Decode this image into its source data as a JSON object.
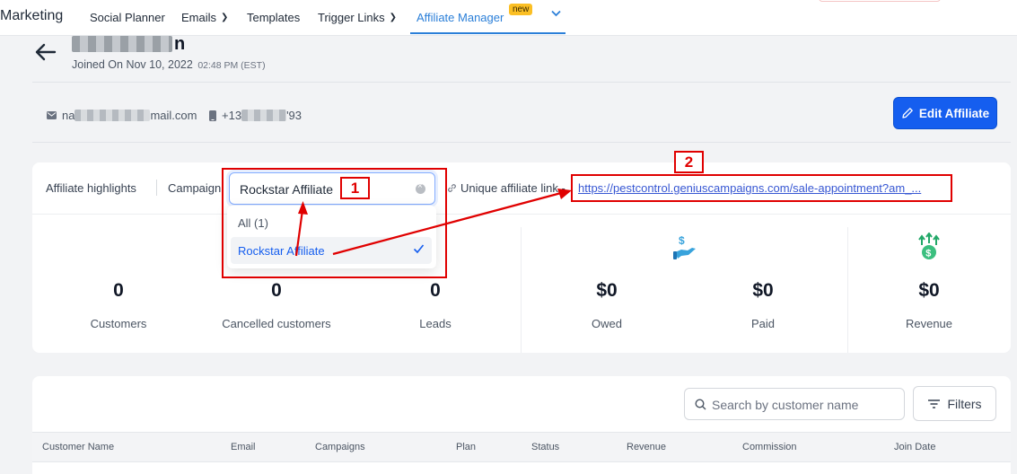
{
  "nav": {
    "brand": "Marketing",
    "items": [
      {
        "label": "Social Planner",
        "has_chevron": false
      },
      {
        "label": "Emails",
        "has_chevron": true
      },
      {
        "label": "Templates",
        "has_chevron": false
      },
      {
        "label": "Trigger Links",
        "has_chevron": true
      },
      {
        "label": "Affiliate Manager",
        "active": true,
        "badge": "new"
      }
    ],
    "active_color": "#2b7fd8"
  },
  "profile": {
    "name_visible_tail": "n",
    "joined_label": "Joined On Nov 10, 2022",
    "joined_time": "02:48 PM (EST)",
    "email_prefix": "na",
    "email_suffix": "mail.com",
    "phone_prefix": "+13",
    "phone_suffix": "'93",
    "edit_button": "Edit Affiliate",
    "accent": "#155eef"
  },
  "highlights": {
    "label": "Affiliate highlights",
    "campaign_label": "Campaign",
    "selected_campaign": "Rockstar Affiliate",
    "dropdown": {
      "all_option": "All (1)",
      "options": [
        "Rockstar Affiliate"
      ]
    },
    "link_label": "Unique affiliate link -",
    "link_url": "https://pestcontrol.geniuscampaigns.com/sale-appointment?am_..."
  },
  "stats": [
    {
      "value": "0",
      "label": "Customers"
    },
    {
      "value": "0",
      "label": "Cancelled customers"
    },
    {
      "value": "0",
      "label": "Leads"
    },
    {
      "value": "$0",
      "label": "Owed",
      "icon": "money-hand-icon"
    },
    {
      "value": "$0",
      "label": "Paid"
    },
    {
      "value": "$0",
      "label": "Revenue",
      "icon": "money-growth-icon"
    }
  ],
  "table": {
    "search_placeholder": "Search by customer name",
    "filters_label": "Filters",
    "columns": [
      "Customer Name",
      "Email",
      "Campaigns",
      "Plan",
      "Status",
      "Revenue",
      "Commission",
      "Join Date"
    ]
  },
  "annotations": {
    "labels": [
      "1",
      "2"
    ],
    "color": "#e00000"
  }
}
